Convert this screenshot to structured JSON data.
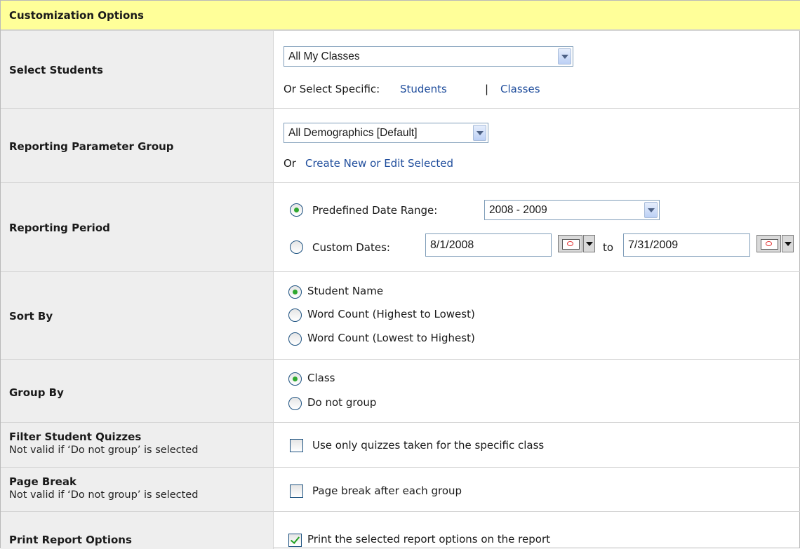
{
  "header": {
    "title": "Customization Options"
  },
  "rows": {
    "select_students": {
      "label": "Select Students",
      "dropdown_value": "All My Classes",
      "or_text": "Or Select Specific:",
      "students_link": "Students",
      "separator": "|",
      "classes_link": "Classes"
    },
    "parameter_group": {
      "label": "Reporting Parameter Group",
      "dropdown_value": "All Demographics [Default]",
      "or_text": "Or",
      "link": "Create New or Edit Selected"
    },
    "reporting_period": {
      "label": "Reporting Period",
      "predefined_label": "Predefined Date Range:",
      "predefined_value": "2008 - 2009",
      "custom_label": "Custom Dates:",
      "start_date": "8/1/2008",
      "to_text": "to",
      "end_date": "7/31/2009",
      "selected": "predefined"
    },
    "sort_by": {
      "label": "Sort By",
      "options": [
        "Student Name",
        "Word Count (Highest to Lowest)",
        "Word Count (Lowest to Highest)"
      ],
      "selected": "Student Name"
    },
    "group_by": {
      "label": "Group By",
      "options": [
        "Class",
        "Do not group"
      ],
      "selected": "Class"
    },
    "filter_quizzes": {
      "label": "Filter Student Quizzes",
      "sublabel": "Not valid if ‘Do not group’ is selected",
      "checkbox_label": "Use only quizzes taken for the specific class",
      "checked": false
    },
    "page_break": {
      "label": "Page Break",
      "sublabel": "Not valid if ‘Do not group’ is selected",
      "checkbox_label": "Page break after each group",
      "checked": false
    },
    "print_options": {
      "label": "Print Report Options",
      "checkbox_label": "Print the selected report options on the report",
      "checked": true
    }
  },
  "colors": {
    "header_bg": "#ffff99",
    "label_bg": "#eeeeee",
    "link": "#1f4d9c",
    "radio_dot": "#2fa82f"
  }
}
